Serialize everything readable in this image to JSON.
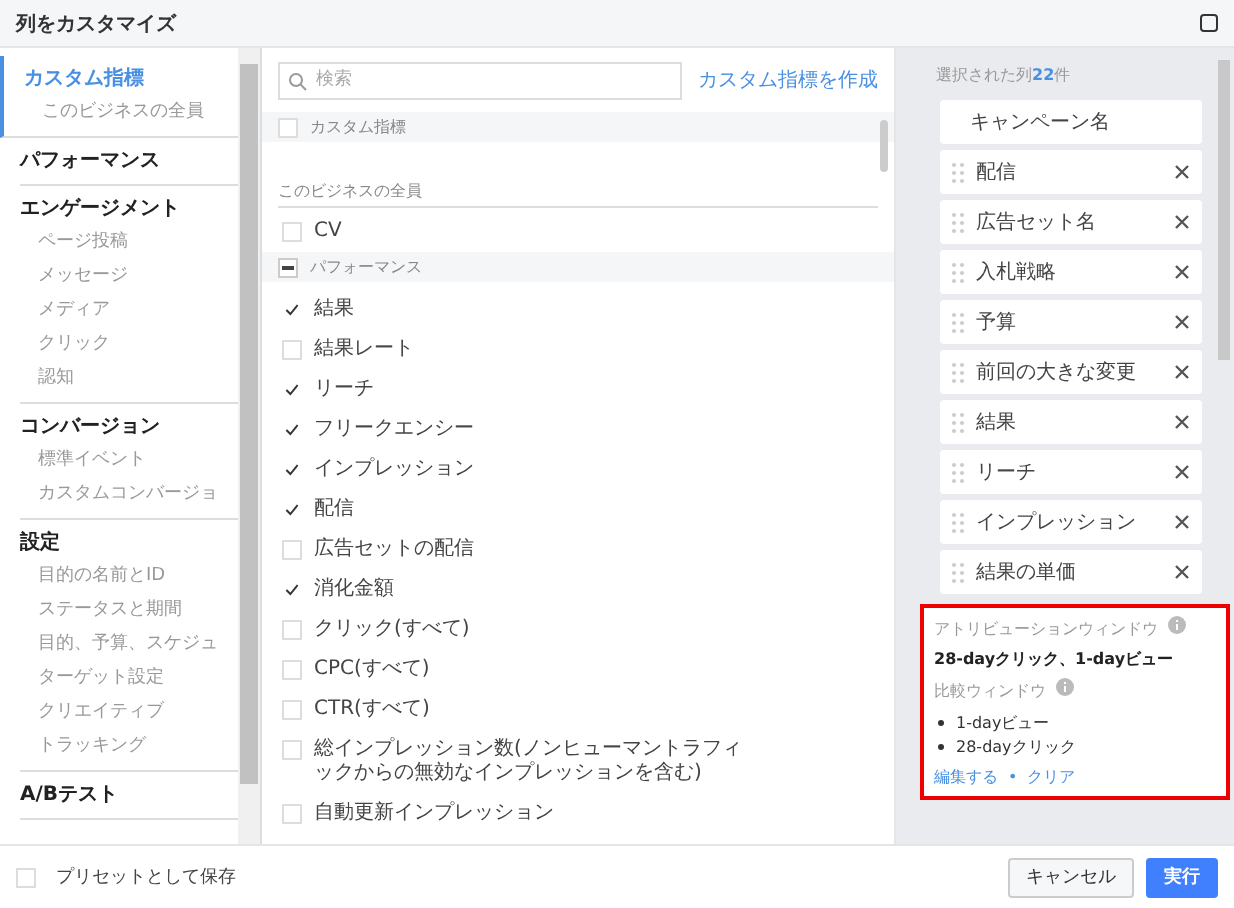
{
  "window": {
    "title": "列をカスタマイズ"
  },
  "nav": [
    {
      "label": "カスタム指標",
      "selected": true,
      "children": [
        {
          "label": "このビジネスの全員",
          "selected": false
        }
      ]
    },
    {
      "label": "パフォーマンス",
      "selected": false
    },
    {
      "label": "エンゲージメント",
      "selected": false,
      "children": [
        {
          "label": "ページ投稿",
          "selected": false
        },
        {
          "label": "メッセージ",
          "selected": false
        },
        {
          "label": "メディア",
          "selected": false
        },
        {
          "label": "クリック",
          "selected": false
        },
        {
          "label": "認知",
          "selected": false
        }
      ]
    },
    {
      "label": "コンバージョン",
      "selected": false,
      "children": [
        {
          "label": "標準イベント",
          "selected": false
        },
        {
          "label": "カスタムコンバージョ",
          "selected": false
        }
      ]
    },
    {
      "label": "設定",
      "selected": false,
      "children": [
        {
          "label": "目的の名前とID",
          "selected": false
        },
        {
          "label": "ステータスと期間",
          "selected": false
        },
        {
          "label": "目的、予算、スケジュ",
          "selected": false
        },
        {
          "label": "ターゲット設定",
          "selected": false
        },
        {
          "label": "クリエイティブ",
          "selected": false
        },
        {
          "label": "トラッキング",
          "selected": false
        }
      ]
    },
    {
      "label": "A/Bテスト",
      "selected": false
    }
  ],
  "search": {
    "placeholder": "検索"
  },
  "create_link": "カスタム指標を作成",
  "metrics": [
    {
      "kind": "header",
      "label": "カスタム指標",
      "partial": false
    },
    {
      "kind": "subheader",
      "label": "このビジネスの全員"
    },
    {
      "kind": "option",
      "label": "CV",
      "checked": false
    },
    {
      "kind": "header",
      "label": "パフォーマンス",
      "partial": true
    },
    {
      "kind": "option",
      "label": "結果",
      "checked": true
    },
    {
      "kind": "option",
      "label": "結果レート",
      "checked": false
    },
    {
      "kind": "option",
      "label": "リーチ",
      "checked": true
    },
    {
      "kind": "option",
      "label": "フリークエンシー",
      "checked": true
    },
    {
      "kind": "option",
      "label": "インプレッション",
      "checked": true
    },
    {
      "kind": "option",
      "label": "配信",
      "checked": true
    },
    {
      "kind": "option",
      "label": "広告セットの配信",
      "checked": false
    },
    {
      "kind": "option",
      "label": "消化金額",
      "checked": true
    },
    {
      "kind": "option",
      "label": "クリック(すべて)",
      "checked": false
    },
    {
      "kind": "option",
      "label": "CPC(すべて)",
      "checked": false
    },
    {
      "kind": "option",
      "label": "CTR(すべて)",
      "checked": false
    },
    {
      "kind": "option",
      "label": "総インプレッション数(ノンヒューマントラフィックからの無効なインプレッションを含む)",
      "checked": false
    },
    {
      "kind": "option",
      "label": "自動更新インプレッション",
      "checked": false
    }
  ],
  "selected_columns": {
    "label": "選択された列",
    "count": "22",
    "unit": "件",
    "items": [
      {
        "label": "キャンペーン名",
        "locked": true
      },
      {
        "label": "配信",
        "locked": false
      },
      {
        "label": "広告セット名",
        "locked": false
      },
      {
        "label": "入札戦略",
        "locked": false
      },
      {
        "label": "予算",
        "locked": false
      },
      {
        "label": "前回の大きな変更",
        "locked": false
      },
      {
        "label": "結果",
        "locked": false
      },
      {
        "label": "リーチ",
        "locked": false
      },
      {
        "label": "インプレッション",
        "locked": false
      },
      {
        "label": "結果の単価",
        "locked": false
      }
    ]
  },
  "attribution": {
    "highlighted": true,
    "title": "アトリビューションウィンドウ",
    "value": "28-dayクリック、1-dayビュー",
    "compare_title": "比較ウィンドウ",
    "compare": [
      "1-dayビュー",
      "28-dayクリック"
    ],
    "edit_link": "編集する",
    "separator": "•",
    "clear_link": "クリア"
  },
  "footer": {
    "preset_label": "プリセットとして保存",
    "preset_checked": false,
    "buttons": [
      {
        "label": "キャンセル",
        "kind": "secondary"
      },
      {
        "label": "実行",
        "kind": "primary"
      }
    ]
  }
}
